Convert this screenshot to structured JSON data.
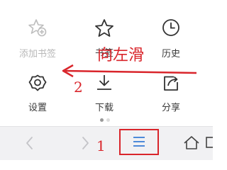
{
  "menu": {
    "items": [
      {
        "label": "添加书签",
        "icon": "bookmark-add-icon",
        "enabled": false
      },
      {
        "label": "书签",
        "icon": "star-icon",
        "enabled": true
      },
      {
        "label": "历史",
        "icon": "clock-icon",
        "enabled": true
      },
      {
        "label": "设置",
        "icon": "gear-icon",
        "enabled": true
      },
      {
        "label": "下载",
        "icon": "download-icon",
        "enabled": true
      },
      {
        "label": "分享",
        "icon": "share-icon",
        "enabled": true
      }
    ],
    "page_indicator": {
      "pages": 2,
      "active_page": 1
    }
  },
  "toolbar": {
    "buttons": [
      {
        "icon": "back-icon",
        "enabled": false
      },
      {
        "icon": "forward-icon",
        "enabled": false
      },
      {
        "icon": "menu-icon",
        "enabled": true,
        "highlighted": true
      },
      {
        "icon": "home-icon",
        "enabled": true
      },
      {
        "icon": "tabs-icon",
        "enabled": true
      }
    ]
  },
  "annotations": {
    "swipe_hint": "向左滑",
    "step_1": "1",
    "step_2": "2"
  },
  "colors": {
    "annotation_red": "#d9252b",
    "icon_dark": "#333333",
    "icon_disabled": "#bdbdbd",
    "toolbar_icon_blue": "#3d7fd6",
    "toolbar_background": "#f1f1f3"
  }
}
